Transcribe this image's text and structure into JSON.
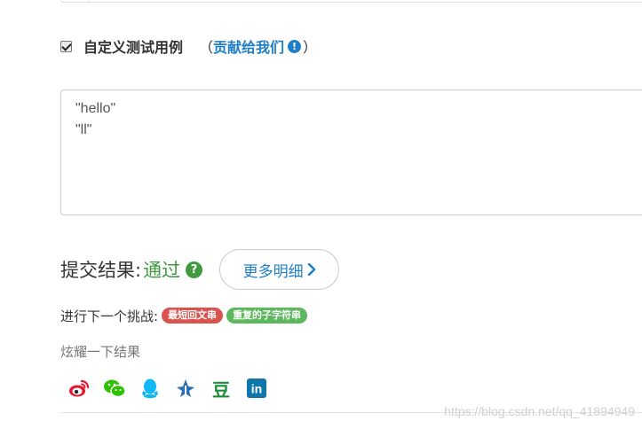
{
  "custom_test": {
    "checked": true,
    "label": "自定义测试用例",
    "paren_open": "（",
    "contribute_link": "贡献给我们",
    "info_glyph": "!",
    "paren_close": "）"
  },
  "test_input": {
    "lines": [
      "\"hello\"",
      "\"ll\""
    ]
  },
  "result": {
    "label": "提交结果:",
    "status": "通过",
    "help_glyph": "?",
    "more_button": "更多明细"
  },
  "challenge": {
    "label": "进行下一个挑战:",
    "tags": [
      {
        "label": "最短回文串",
        "color": "#d9534f"
      },
      {
        "label": "重复的子字符串",
        "color": "#5cb85c"
      }
    ]
  },
  "share": {
    "label": "炫耀一下结果",
    "icons": [
      "weibo-icon",
      "wechat-icon",
      "qq-icon",
      "qzone-icon",
      "douban-icon",
      "linkedin-icon"
    ],
    "douban_text": "豆",
    "linkedin_text": "in"
  },
  "watermark": "https://blog.csdn.net/qq_41894949",
  "colors": {
    "link_blue": "#1f7fc6",
    "success_green": "#3f9a3f",
    "tag_red": "#d9534f",
    "tag_green": "#5cb85c"
  }
}
